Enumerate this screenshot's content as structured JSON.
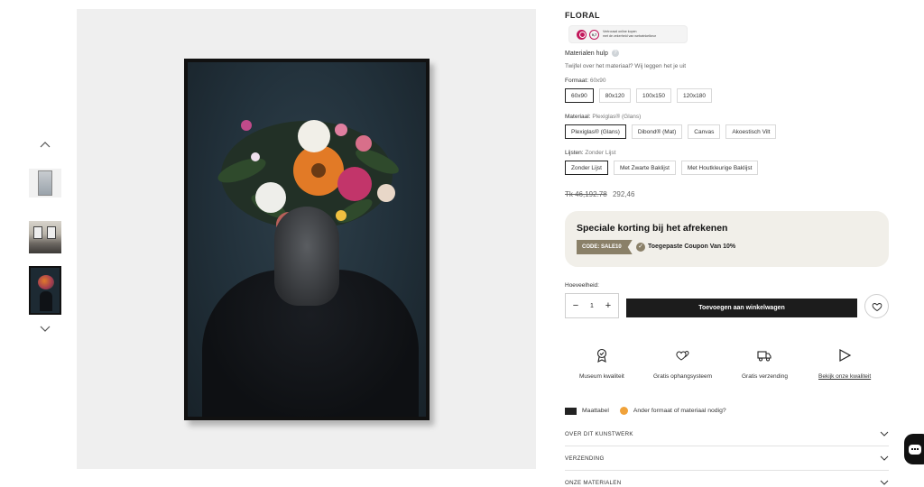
{
  "product": {
    "title": "FLORAL"
  },
  "trust_badge": {
    "score": "9,7",
    "line1": "Vertrouwd online kopen",
    "line2": "met de zekerheid van webwinkelkeur"
  },
  "materials_help": {
    "label": "Materialen hulp",
    "question_mark": "?",
    "subtext": "Twijfel over het materiaal? Wij leggen het je uit"
  },
  "format": {
    "label": "Formaat:",
    "selected": "60x90",
    "options": [
      "60x90",
      "80x120",
      "100x150",
      "120x180"
    ]
  },
  "material": {
    "label": "Materiaal:",
    "selected": "Plexiglas® (Glans)",
    "options": [
      "Plexiglas® (Glans)",
      "Dibond® (Mat)",
      "Canvas",
      "Akoestisch Vilt"
    ]
  },
  "frame": {
    "label": "Lijsten:",
    "selected": "Zonder Lijst",
    "options": [
      "Zonder Lijst",
      "Met Zwarte Baklijst",
      "Met Houtkleurige Baklijst"
    ]
  },
  "price": {
    "old": "Tk 46,192.78",
    "current": "292,46"
  },
  "promo": {
    "title": "Speciale korting bij het afrekenen",
    "code": "CODE: SALE10",
    "check": "✓",
    "applied": "Toegepaste Coupon Van 10%"
  },
  "quantity": {
    "label": "Hoeveelheid:",
    "value": "1",
    "minus": "−",
    "plus": "+"
  },
  "cart": {
    "label": "Toevoegen aan winkelwagen"
  },
  "features": [
    {
      "label": "Museum kwaliteit",
      "icon": "award-icon"
    },
    {
      "label": "Gratis ophangsysteem",
      "icon": "hearts-icon"
    },
    {
      "label": "Gratis verzending",
      "icon": "truck-icon"
    },
    {
      "label": "Bekijk onze kwaliteit",
      "icon": "play-icon"
    }
  ],
  "extras": {
    "size_table": "Maattabel",
    "other_format": "Ander formaat of materiaal nodig?"
  },
  "accordion": [
    {
      "label": "OVER DIT KUNSTWERK"
    },
    {
      "label": "VERZENDING"
    },
    {
      "label": "ONZE MATERIALEN"
    }
  ],
  "colors": {
    "promo_bg": "#f1efe9",
    "promo_tag": "#8a8068",
    "cart_button": "#1c1c1c",
    "badge_accent": "#c2185b"
  }
}
